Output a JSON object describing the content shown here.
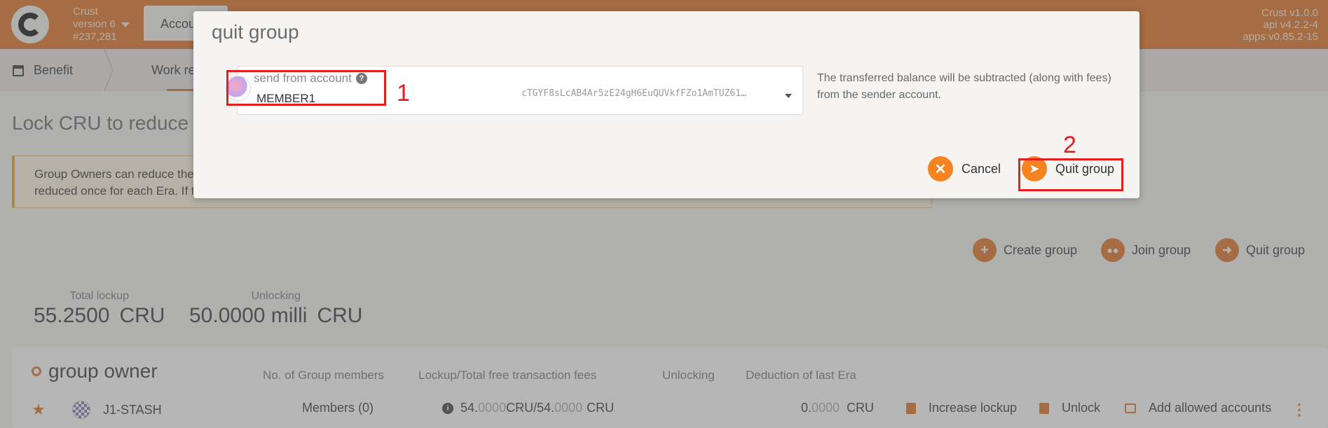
{
  "header": {
    "chain_name": "Crust",
    "chain_version": "version 6",
    "block": "#237,281",
    "accounts_tab": "Accounts",
    "versions": [
      "Crust v1.0.0",
      "api v4.2.2-4",
      "apps v0.85.2-15"
    ]
  },
  "subnav": {
    "benefit": "Benefit",
    "work_report": "Work re"
  },
  "page": {
    "title": "Lock CRU to reduce t",
    "notice_line1": "Group Owners can reduce the",
    "notice_line2": "reduced once for each Era. If t",
    "actions": {
      "create_group": "Create group",
      "join_group": "Join group",
      "quit_group": "Quit group"
    },
    "stats": {
      "total_lockup_label": "Total lockup",
      "total_lockup_value": "55.2500",
      "total_lockup_unit": "CRU",
      "unlocking_label": "Unlocking",
      "unlocking_value": "50.0000 milli",
      "unlocking_unit": "CRU"
    },
    "table": {
      "title": "group owner",
      "headers": [
        "No. of Group members",
        "Lockup/Total free transaction fees",
        "Unlocking",
        "Deduction of last Era"
      ],
      "row": {
        "account": "J1-STASH",
        "members": "Members (0)",
        "lockup_int": "54.",
        "lockup_dec": "0000",
        "lockup_sep": "CRU/",
        "total_int": "54.",
        "total_dec": "0000",
        "total_unit": "CRU",
        "deduction_int": "0.",
        "deduction_dec": "0000",
        "deduction_unit": "CRU",
        "increase_lockup": "Increase lockup",
        "unlock": "Unlock",
        "add_allowed": "Add allowed accounts"
      }
    }
  },
  "modal": {
    "title": "quit group",
    "account_label": "send from account",
    "account_name": "MEMBER1",
    "account_address": "cTGYF8sLcAB4Ar5zE24gH6EuQUVkfFZo1AmTUZ61…",
    "hint": "The transferred balance will be subtracted (along with fees) from the sender account.",
    "cancel_label": "Cancel",
    "submit_label": "Quit group"
  },
  "annotations": [
    "1",
    "2"
  ],
  "colors": {
    "accent": "#e3803a",
    "annotation": "#e51e1e"
  }
}
